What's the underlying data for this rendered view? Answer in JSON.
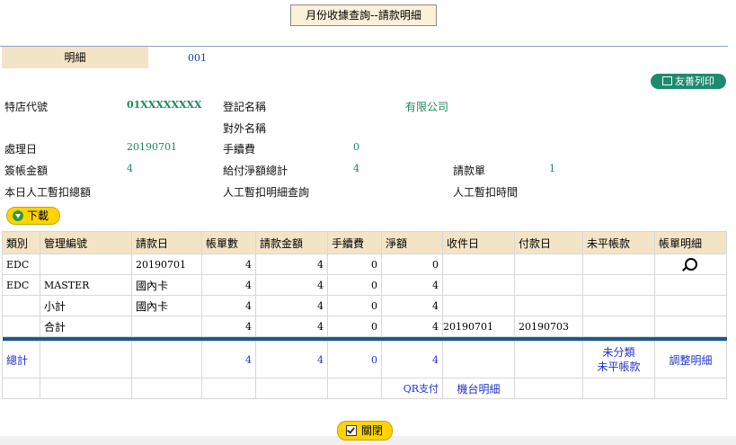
{
  "title": "月份收據查詢--請款明細",
  "tabs": {
    "active": "明細",
    "inactive": "001"
  },
  "print_button": "友善列印",
  "info": {
    "merchant_id_label": "特店代號",
    "merchant_id": "01XXXXXXXX",
    "reg_name_label": "登記名稱",
    "reg_name": "有限公司",
    "ext_name_label": "對外名稱",
    "process_date_label": "處理日",
    "process_date": "20190701",
    "fee_label": "手續費",
    "fee": "0",
    "sign_amount_label": "簽帳金額",
    "sign_amount": "4",
    "net_total_label": "給付淨額總計",
    "net_total": "4",
    "request_form_label": "請款單",
    "request_form": "1",
    "manual_deduct_total_label": "本日人工暫扣總額",
    "manual_deduct_query_label": "人工暫扣明細查詢",
    "manual_deduct_time_label": "人工暫扣時間"
  },
  "download_button": "下載",
  "table": {
    "headers": [
      "類別",
      "管理編號",
      "請款日",
      "帳單數",
      "請款金額",
      "手續費",
      "淨額",
      "收件日",
      "付款日",
      "未平帳款",
      "帳單明細"
    ],
    "rows": [
      [
        "EDC",
        "",
        "20190701",
        "4",
        "4",
        "0",
        "0",
        "",
        "",
        "",
        ""
      ],
      [
        "EDC",
        "MASTER",
        "國內卡",
        "4",
        "4",
        "0",
        "4",
        "",
        "",
        "",
        ""
      ],
      [
        "",
        "小計",
        "國內卡",
        "4",
        "4",
        "0",
        "4",
        "",
        "",
        "",
        ""
      ],
      [
        "",
        "合計",
        "",
        "4",
        "4",
        "0",
        "4",
        "20190701",
        "20190703",
        "",
        ""
      ]
    ],
    "total_row": [
      "總計",
      "",
      "",
      "4",
      "4",
      "0",
      "4",
      "",
      "",
      "未分類\n未平帳款",
      "調整明細"
    ],
    "links": {
      "qr": "QR支付",
      "terminal": "機台明細"
    }
  },
  "close_button": "關閉",
  "colors": {
    "header_bg": "#f3e4c6",
    "value_green": "#1a8a5c",
    "link_blue": "#2233cc",
    "separator": "#1a5a8a"
  }
}
